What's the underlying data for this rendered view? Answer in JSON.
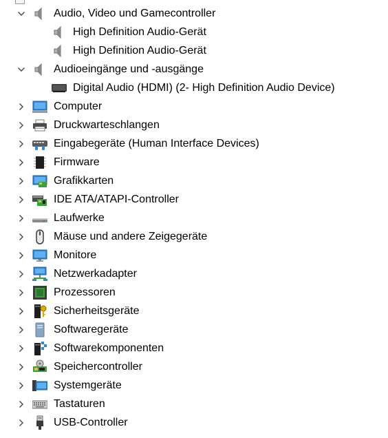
{
  "colors": {
    "chevron": "#444444",
    "text": "#000000",
    "background": "#ffffff"
  },
  "tree": [
    {
      "label": "Audio, Video und Gamecontroller",
      "level": 0,
      "expanded": true,
      "icon": "speaker-icon"
    },
    {
      "label": "High Definition Audio-Gerät",
      "level": 1,
      "icon": "speaker-icon"
    },
    {
      "label": "High Definition Audio-Gerät",
      "level": 1,
      "icon": "speaker-icon"
    },
    {
      "label": "Audioeingänge und -ausgänge",
      "level": 0,
      "expanded": true,
      "icon": "speaker-icon"
    },
    {
      "label": "Digital Audio (HDMI) (2- High Definition Audio Device)",
      "level": 1,
      "icon": "monitor-dark-icon"
    },
    {
      "label": "Computer",
      "level": 0,
      "expanded": false,
      "icon": "computer-icon"
    },
    {
      "label": "Druckwarteschlangen",
      "level": 0,
      "expanded": false,
      "icon": "printer-icon"
    },
    {
      "label": "Eingabegeräte (Human Interface Devices)",
      "level": 0,
      "expanded": false,
      "icon": "hid-icon"
    },
    {
      "label": "Firmware",
      "level": 0,
      "expanded": false,
      "icon": "firmware-icon"
    },
    {
      "label": "Grafikkarten",
      "level": 0,
      "expanded": false,
      "icon": "display-adapter-icon"
    },
    {
      "label": "IDE ATA/ATAPI-Controller",
      "level": 0,
      "expanded": false,
      "icon": "ide-controller-icon"
    },
    {
      "label": "Laufwerke",
      "level": 0,
      "expanded": false,
      "icon": "drive-icon"
    },
    {
      "label": "Mäuse und andere Zeigegeräte",
      "level": 0,
      "expanded": false,
      "icon": "mouse-icon"
    },
    {
      "label": "Monitore",
      "level": 0,
      "expanded": false,
      "icon": "monitor-icon"
    },
    {
      "label": "Netzwerkadapter",
      "level": 0,
      "expanded": false,
      "icon": "network-icon"
    },
    {
      "label": "Prozessoren",
      "level": 0,
      "expanded": false,
      "icon": "processor-icon"
    },
    {
      "label": "Sicherheitsgeräte",
      "level": 0,
      "expanded": false,
      "icon": "security-icon"
    },
    {
      "label": "Softwaregeräte",
      "level": 0,
      "expanded": false,
      "icon": "software-device-icon"
    },
    {
      "label": "Softwarekomponenten",
      "level": 0,
      "expanded": false,
      "icon": "software-component-icon"
    },
    {
      "label": "Speichercontroller",
      "level": 0,
      "expanded": false,
      "icon": "storage-controller-icon"
    },
    {
      "label": "Systemgeräte",
      "level": 0,
      "expanded": false,
      "icon": "system-device-icon"
    },
    {
      "label": "Tastaturen",
      "level": 0,
      "expanded": false,
      "icon": "keyboard-icon"
    },
    {
      "label": "USB-Controller",
      "level": 0,
      "expanded": false,
      "icon": "usb-icon"
    }
  ]
}
